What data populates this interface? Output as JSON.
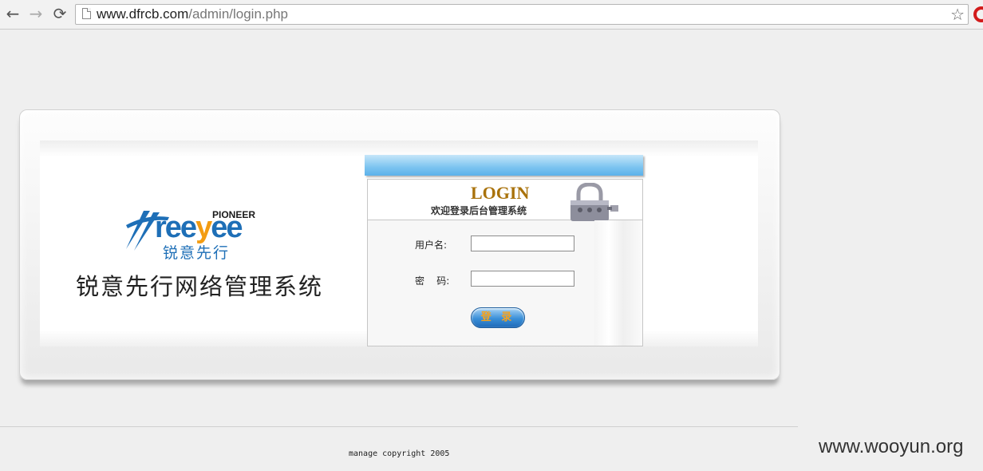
{
  "browser": {
    "url_host": "www.dfrcb.com",
    "url_path": "/admin/login.php",
    "back_icon": "←",
    "forward_icon": "→",
    "reload_icon": "⟳",
    "star_icon": "☆"
  },
  "logo": {
    "word_prefix": "ree",
    "word_accent": "y",
    "word_suffix": "ee",
    "tagline_en": "PIONEER",
    "tagline_cn": "锐意先行"
  },
  "system_title": "锐意先行网络管理系统",
  "login": {
    "heading": "LOGIN",
    "subheading": "欢迎登录后台管理系统",
    "username_label": "用户名:",
    "password_label": "密    码:",
    "username_value": "",
    "password_value": "",
    "submit_label": "登 录"
  },
  "footer": {
    "copyright": "manage copyright 2005"
  },
  "watermark": "www.wooyun.org",
  "colors": {
    "brand_blue": "#1e6fb7",
    "brand_orange": "#f39c12",
    "login_heading": "#a9720b",
    "button_blue": "#3a8fd8"
  }
}
